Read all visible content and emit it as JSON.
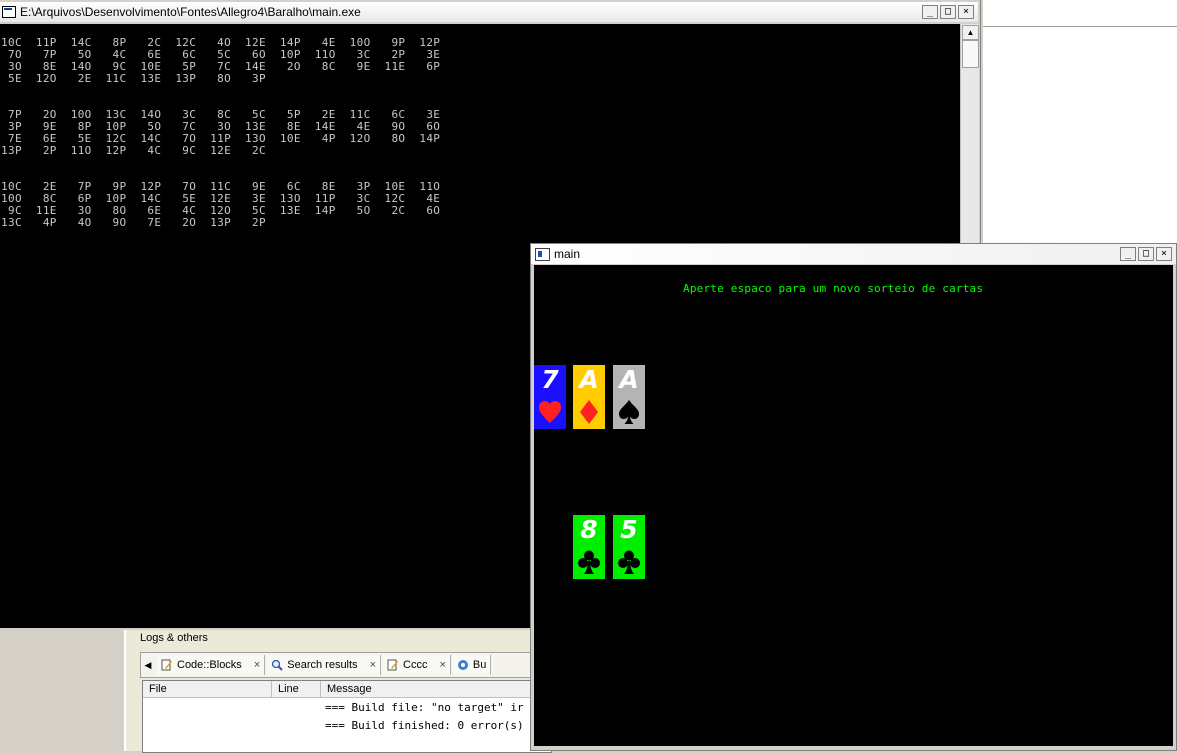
{
  "console": {
    "title": "E:\\Arquivos\\Desenvolvimento\\Fontes\\Allegro4\\Baralho\\main.exe",
    "controls": {
      "minimize": "_",
      "maximize": "□",
      "close": "×"
    },
    "output": "10C  11P  14C   8P   2C  12C   4O  12E  14P   4E  10O   9P  12P\n 7O   7P   5O   4C   6E   6C   5C   6O  10P  11O   3C   2P   3E\n 3O   8E  14O   9C  10E   5P   7C  14E   2O   8C   9E  11E   6P\n 5E  12O   2E  11C  13E  13P   8O   3P\n\n\n 7P   2O  10O  13C  14O   3C   8C   5C   5P   2E  11C   6C   3E\n 3P   9E   8P  10P   5O   7C   3O  13E   8E  14E   4E   9O   6O\n 7E   6E   5E  12C  14C   7O  11P  13O  10E   4P  12O   8O  14P\n13P   2P  11O  12P   4C   9C  12E   2C\n\n\n10C   2E   7P   9P  12P   7O  11C   9E   6C   8E   3P  10E  11O\n10O   8C   6P  10P  14C   5E  12E   3E  13O  11P   3C  12C   4E\n 9C  11E   3O   8O   6E   4C  12O   5C  13E  14P   5O   2C   6O\n13C   4P   4O   9O   7E   2O  13P   2P"
  },
  "logs": {
    "panel_title": "Logs & others",
    "tabs": [
      {
        "label": "Code::Blocks",
        "close": "×"
      },
      {
        "label": "Search results",
        "close": "×"
      },
      {
        "label": "Cccc",
        "close": "×"
      },
      {
        "label": "Bu"
      }
    ],
    "columns": [
      "File",
      "Line",
      "Message"
    ],
    "rows": [
      "=== Build file: \"no target\" ir",
      "=== Build finished: 0 error(s)"
    ]
  },
  "main_window": {
    "title": "main",
    "controls": {
      "minimize": "_",
      "maximize": "□",
      "close": "×"
    },
    "message": "Aperte espaco para um novo sorteio de cartas",
    "cards": [
      {
        "rank": "7",
        "suit": "heart",
        "bg": "#1a10ff",
        "suit_color": "#ff2020"
      },
      {
        "rank": "A",
        "suit": "diamond",
        "bg": "#ffcc00",
        "suit_color": "#ff2020"
      },
      {
        "rank": "A",
        "suit": "spade",
        "bg": "#b4b4b4",
        "suit_color": "#000000"
      },
      {
        "rank": "8",
        "suit": "club",
        "bg": "#00ee00",
        "suit_color": "#000000"
      },
      {
        "rank": "5",
        "suit": "club",
        "bg": "#00ee00",
        "suit_color": "#000000"
      }
    ]
  }
}
